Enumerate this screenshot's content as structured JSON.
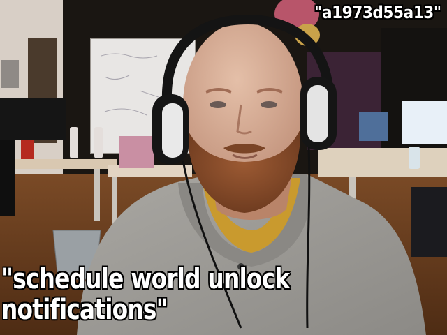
{
  "image": {
    "description": "webcam photo of a bald, bearded man wearing black-and-white over-ear headphones and a grey hoodie over a yellow shirt, in an office with desks, a whiteboard, a trash bin and monitors",
    "top_caption": "\"a1973d55a13\"",
    "bottom_caption": {
      "line1": "\"schedule world unlock",
      "line2": "notifications\""
    }
  }
}
